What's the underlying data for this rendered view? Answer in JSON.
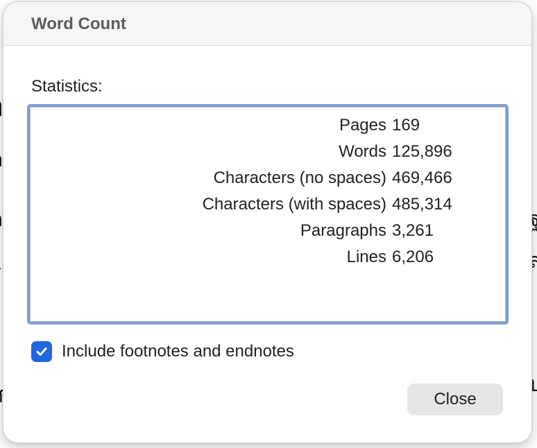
{
  "dialog": {
    "title": "Word Count",
    "statistics_label": "Statistics:",
    "stats": [
      {
        "label": "Pages",
        "value": "169"
      },
      {
        "label": "Words",
        "value": "125,896"
      },
      {
        "label": "Characters (no spaces)",
        "value": "469,466"
      },
      {
        "label": "Characters (with spaces)",
        "value": "485,314"
      },
      {
        "label": "Paragraphs",
        "value": "3,261"
      },
      {
        "label": "Lines",
        "value": "6,206"
      }
    ],
    "include_notes": {
      "label": "Include footnotes and endnotes",
      "checked": true
    },
    "close_label": "Close"
  },
  "colors": {
    "checkbox_accent": "#1f67e0",
    "focus_ring": "#7f9ed3",
    "title_text": "#5c5c5c",
    "button_bg": "#e6e6e6"
  },
  "icons": {
    "checkbox_check": "checkmark-icon"
  }
}
